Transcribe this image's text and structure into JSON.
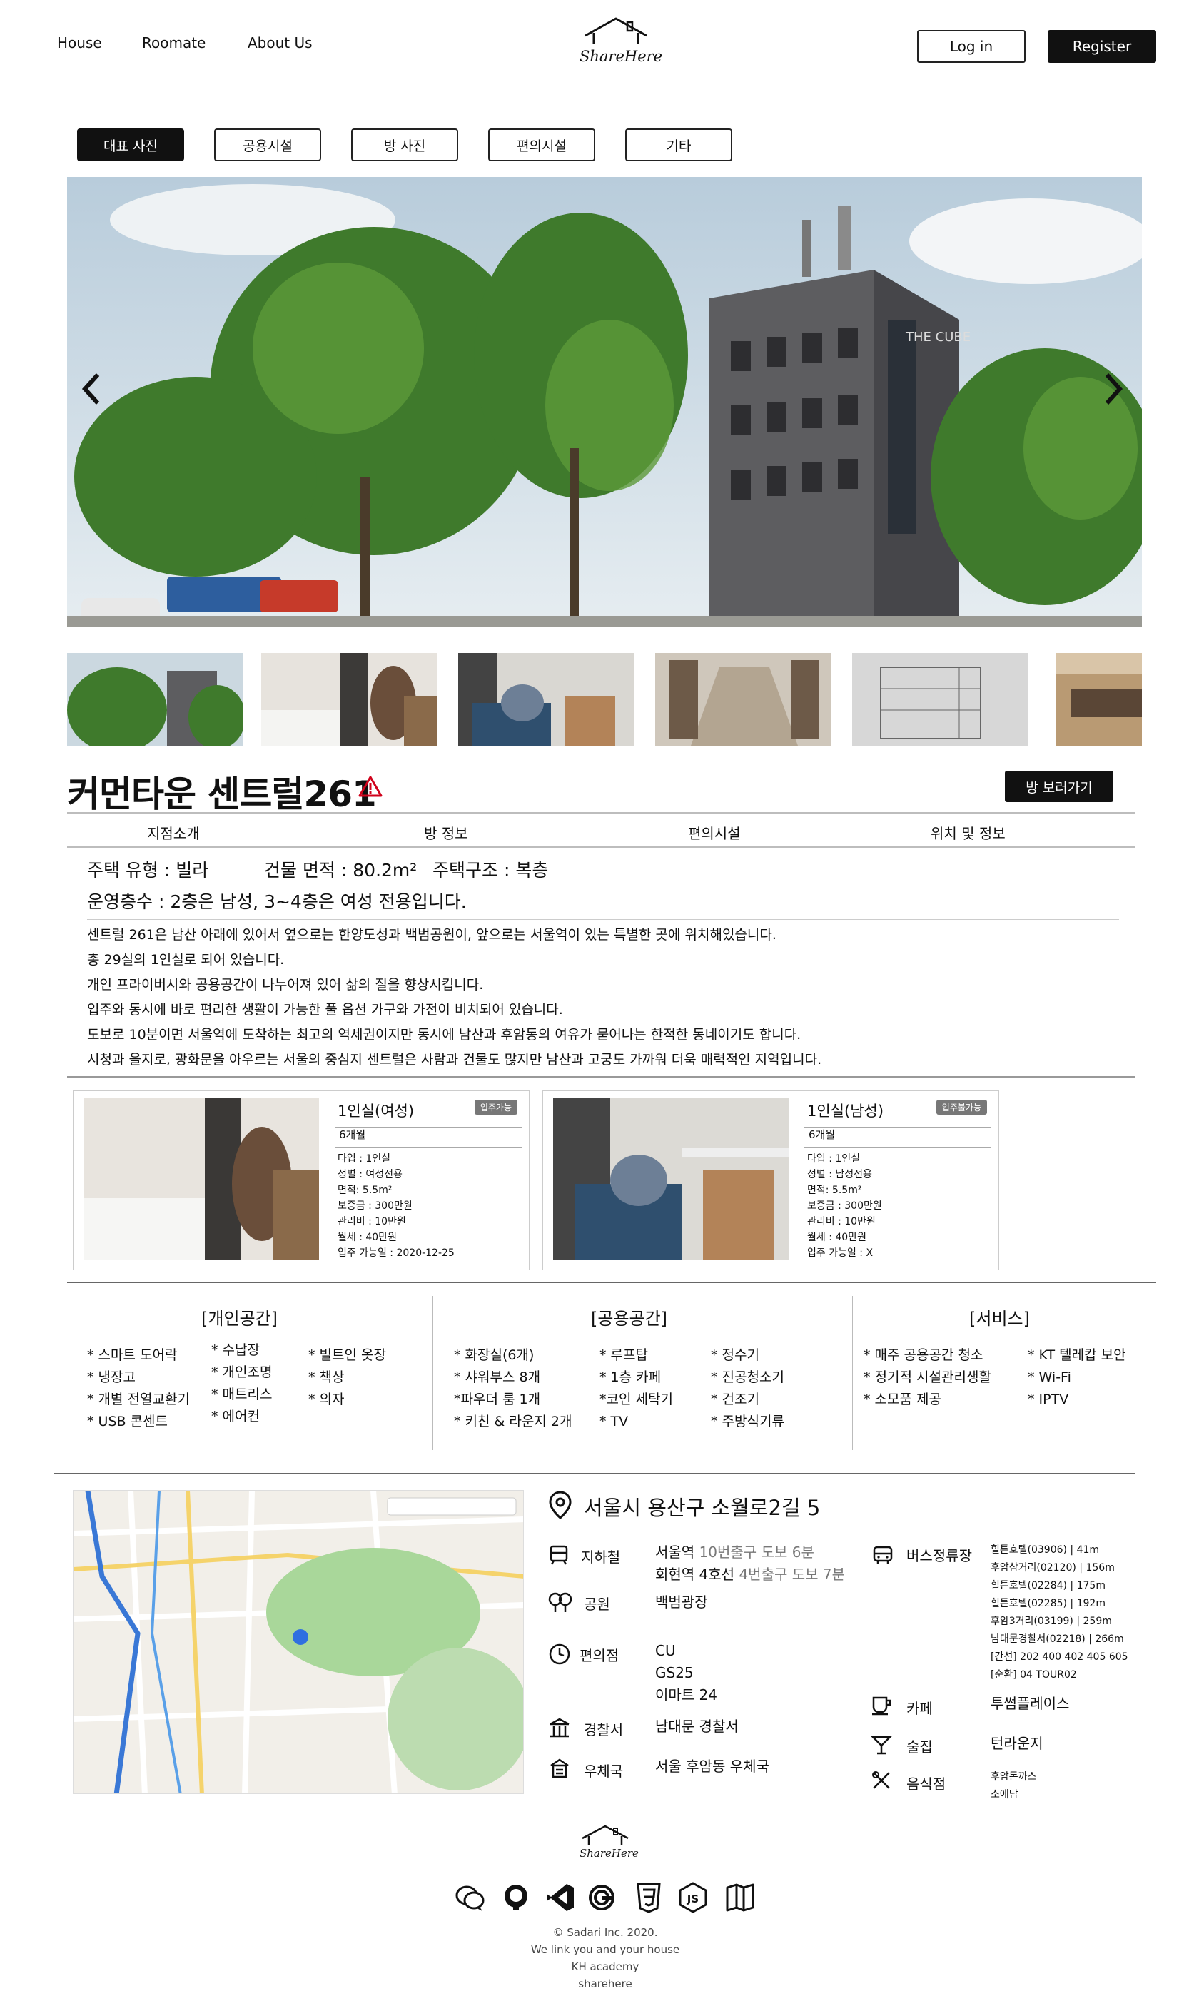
{
  "header": {
    "nav": [
      "House",
      "Roomate",
      "About Us"
    ],
    "logo_text": "ShareHere",
    "login_label": "Log in",
    "register_label": "Register"
  },
  "photo_tabs": [
    "대표 사진",
    "공용시설",
    "방 사진",
    "편의시설",
    "기타"
  ],
  "hero": {
    "building_sign": "THE CUBE"
  },
  "listing": {
    "title": "커먼타운 센트럴261",
    "view_room_label": "방 보러가기",
    "section_tabs": [
      "지점소개",
      "방 정보",
      "편의시설",
      "위치 및 정보"
    ],
    "house_type": "주택 유형 : 빌라",
    "area": "건물 면적 : 80.2m²",
    "structure": "주택구조 : 복층",
    "floors": "운영층수 : 2층은 남성, 3~4층은 여성 전용입니다.",
    "description": [
      "센트럴 261은 남산 아래에 있어서 옆으로는 한양도성과 백범공원이, 앞으로는 서울역이 있는 특별한 곳에 위치해있습니다.",
      "총 29실의 1인실로 되어 있습니다.",
      "개인 프라이버시와 공용공간이 나누어져 있어 삶의 질을 향상시킵니다.",
      "입주와 동시에 바로 편리한 생활이 가능한 풀 옵션 가구와 가전이 비치되어 있습니다.",
      "도보로 10분이면 서울역에 도착하는 최고의 역세권이지만 동시에 남산과 후암동의 여유가 묻어나는 한적한 동네이기도 합니다.",
      "시청과 을지로, 광화문을 아우르는 서울의 중심지 센트럴은 사람과 건물도 많지만 남산과 고궁도 가까워 더욱 매력적인 지역입니다."
    ]
  },
  "rooms": [
    {
      "title": "1인실(여성)",
      "badge": "입주가능",
      "period": "6개월",
      "details": [
        "타입 : 1인실",
        "성별 : 여성전용",
        "면적: 5.5m²",
        "보증금 : 300만원",
        "관리비 : 10만원",
        "월세 : 40만원",
        "입주 가능일 : 2020-12-25"
      ]
    },
    {
      "title": "1인실(남성)",
      "badge": "입주불가능",
      "period": "6개월",
      "details": [
        "타입 : 1인실",
        "성별 : 남성전용",
        "면적: 5.5m²",
        "보증금 : 300만원",
        "관리비 : 10만원",
        "월세 : 40만원",
        "입주 가능일 : X"
      ]
    }
  ],
  "facilities": {
    "private": {
      "title": "[개인공간]",
      "col1": [
        "* 스마트 도어락",
        "* 냉장고",
        "* 개별 전열교환기",
        "* USB 콘센트"
      ],
      "col2": [
        "* 수납장",
        "* 개인조명",
        "* 매트리스",
        "* 에어컨"
      ],
      "col3": [
        "* 빌트인 옷장",
        "* 책상",
        "* 의자"
      ]
    },
    "shared": {
      "title": "[공용공간]",
      "col1": [
        "* 화장실(6개)",
        "* 샤워부스 8개",
        "*파우더 룸 1개",
        "* 키친 & 라운지 2개"
      ],
      "col2": [
        "* 루프탑",
        "* 1층 카페",
        "*코인 세탁기",
        "* TV"
      ],
      "col3": [
        "* 정수기",
        "* 진공청소기",
        "* 건조기",
        "* 주방식기류"
      ]
    },
    "service": {
      "title": "[서비스]",
      "col1": [
        "* 매주 공용공간 청소",
        "* 정기적 시설관리생활",
        "* 소모품 제공"
      ],
      "col2": [
        "* KT 텔레캅 보안",
        "* Wi-Fi",
        "* IPTV"
      ]
    }
  },
  "location": {
    "address": "서울시 용산구 소월로2길 5",
    "subway_label": "지하철",
    "subway": [
      {
        "station": "서울역",
        "detail": "10번출구 도보 6분"
      },
      {
        "station": "회현역 4호선",
        "detail": "4번출구 도보 7분"
      }
    ],
    "park_label": "공원",
    "park": "백범광장",
    "store_label": "편의점",
    "stores": [
      "CU",
      "GS25",
      "이마트 24"
    ],
    "police_label": "경찰서",
    "police": "남대문 경찰서",
    "post_label": "우체국",
    "post": "서울 후암동 우체국",
    "bus_label": "버스정류장",
    "bus": [
      "힐튼호텔(03906) | 41m",
      "후암삼거리(02120) | 156m",
      "힐튼호텔(02284) | 175m",
      "힐튼호텔(02285) | 192m",
      "후암3거리(03199) | 259m",
      "남대문경찰서(02218) | 266m",
      "[간선] 202 400 402 405 605",
      "[순환] 04 TOUR02"
    ],
    "cafe_label": "카페",
    "cafe": "투썸플레이스",
    "bar_label": "술집",
    "bar": "턴라운지",
    "food_label": "음식점",
    "food": [
      "후암돈까스",
      "소애담"
    ]
  },
  "footer": {
    "logo_text": "ShareHere",
    "icons": [
      "chat-icon",
      "github-icon",
      "vscode-icon",
      "google-icon",
      "css3-icon",
      "js-icon",
      "book-icon"
    ],
    "lines": [
      "© Sadari Inc. 2020.",
      "We link you and your house",
      "KH academy",
      "sharehere"
    ]
  }
}
